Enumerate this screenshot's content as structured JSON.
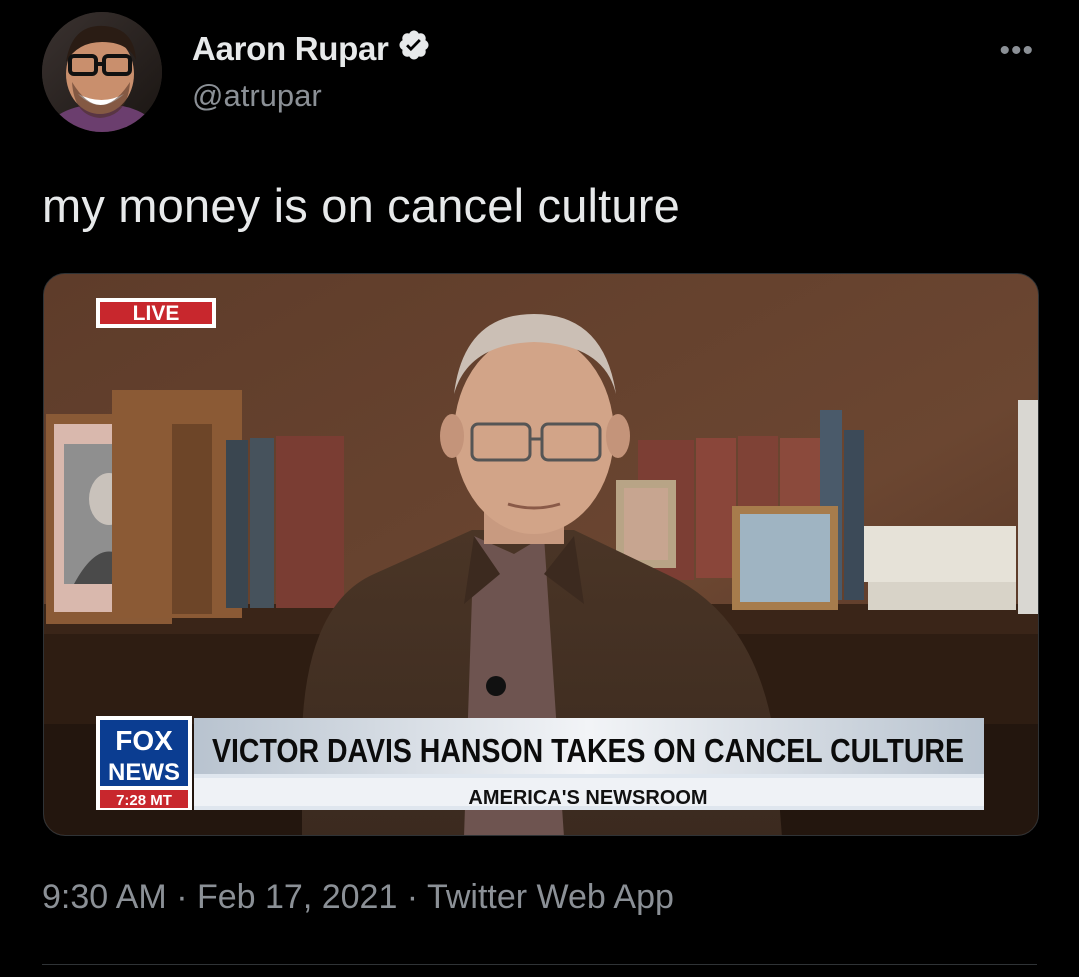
{
  "author": {
    "display_name": "Aaron Rupar",
    "handle": "@atrupar",
    "verified": true,
    "verified_icon": "verified-badge-icon",
    "avatar_icon": "avatar"
  },
  "more_label": "•••",
  "tweet": {
    "text": "my money is on cancel culture"
  },
  "media": {
    "live_label": "LIVE",
    "network_logo_line1": "FOX",
    "network_logo_line2": "NEWS",
    "time_label": "7:28 MT",
    "headline": "VICTOR DAVIS HANSON TAKES ON CANCEL CULTURE",
    "show_name": "AMERICA'S NEWSROOM"
  },
  "meta": {
    "time": "9:30 AM",
    "separator": " · ",
    "date": "Feb 17, 2021",
    "source": "Twitter Web App"
  },
  "colors": {
    "background": "#000000",
    "text_primary": "#e7e9ea",
    "text_secondary": "#8b9096",
    "live_red": "#c8272d",
    "fox_blue": "#0b3d91"
  }
}
